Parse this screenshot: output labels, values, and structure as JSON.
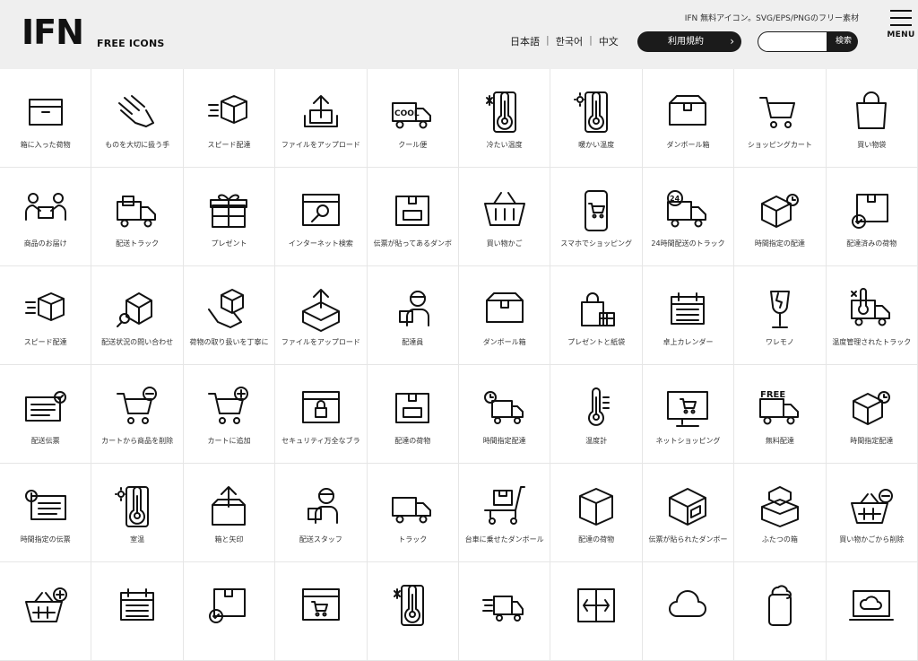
{
  "header": {
    "logo": "IFN",
    "logo_sub": "FREE ICONS",
    "tagline": "IFN 無料アイコン。SVG/EPS/PNGのフリー素材",
    "languages": [
      "日本語",
      "한국어",
      "中文"
    ],
    "terms_label": "利用規約",
    "search_button": "検索",
    "search_value": "",
    "menu_label": "MENU"
  },
  "icons": [
    {
      "label": "箱に入った荷物",
      "icon": "box-icon"
    },
    {
      "label": "ものを大切に扱う手",
      "icon": "hand-icon"
    },
    {
      "label": "スピード配達",
      "icon": "speed-box-icon"
    },
    {
      "label": "ファイルをアップロード",
      "icon": "upload-tray-icon"
    },
    {
      "label": "クール便",
      "icon": "cool-truck-icon"
    },
    {
      "label": "冷たい温度",
      "icon": "cold-thermometer-icon"
    },
    {
      "label": "暖かい温度",
      "icon": "warm-thermometer-icon"
    },
    {
      "label": "ダンボール箱",
      "icon": "cardboard-box-icon"
    },
    {
      "label": "ショッピングカート",
      "icon": "cart-icon"
    },
    {
      "label": "買い物袋",
      "icon": "shopping-bag-icon"
    },
    {
      "label": "商品のお届け",
      "icon": "handover-icon"
    },
    {
      "label": "配送トラック",
      "icon": "delivery-truck-icon"
    },
    {
      "label": "プレゼント",
      "icon": "gift-icon"
    },
    {
      "label": "インターネット検索",
      "icon": "browser-search-icon"
    },
    {
      "label": "伝票が貼ってあるダンボ",
      "icon": "box-label-icon"
    },
    {
      "label": "買い物かご",
      "icon": "basket-icon"
    },
    {
      "label": "スマホでショッピング",
      "icon": "phone-cart-icon"
    },
    {
      "label": "24時間配送のトラック",
      "icon": "truck-24-icon"
    },
    {
      "label": "時間指定の配達",
      "icon": "box-clock-icon"
    },
    {
      "label": "配達済みの荷物",
      "icon": "box-check-icon"
    },
    {
      "label": "スピード配達",
      "icon": "speed-box-icon"
    },
    {
      "label": "配送状況の問い合わせ",
      "icon": "box-search-icon"
    },
    {
      "label": "荷物の取り扱いを丁寧に",
      "icon": "hand-box-icon"
    },
    {
      "label": "ファイルをアップロード",
      "icon": "box-upload-icon"
    },
    {
      "label": "配達員",
      "icon": "courier-icon"
    },
    {
      "label": "ダンボール箱",
      "icon": "cardboard-box-icon"
    },
    {
      "label": "プレゼントと紙袋",
      "icon": "bag-gift-icon"
    },
    {
      "label": "卓上カレンダー",
      "icon": "calendar-icon"
    },
    {
      "label": "ワレモノ",
      "icon": "fragile-glass-icon"
    },
    {
      "label": "温度管理されたトラック",
      "icon": "thermo-truck-icon"
    },
    {
      "label": "配送伝票",
      "icon": "slip-check-icon"
    },
    {
      "label": "カートから商品を削除",
      "icon": "cart-minus-icon"
    },
    {
      "label": "カートに追加",
      "icon": "cart-plus-icon"
    },
    {
      "label": "セキュリティ万全なブラ",
      "icon": "browser-lock-icon"
    },
    {
      "label": "配達の荷物",
      "icon": "box-label-icon"
    },
    {
      "label": "時間指定配達",
      "icon": "clock-truck-icon"
    },
    {
      "label": "温度計",
      "icon": "thermometer-icon"
    },
    {
      "label": "ネットショッピング",
      "icon": "monitor-cart-icon"
    },
    {
      "label": "無料配達",
      "icon": "free-truck-icon"
    },
    {
      "label": "時間指定配達",
      "icon": "box-clock-icon"
    },
    {
      "label": "時間指定の伝票",
      "icon": "clock-slip-icon"
    },
    {
      "label": "室温",
      "icon": "warm-thermometer-icon"
    },
    {
      "label": "箱と矢印",
      "icon": "box-arrow-icon"
    },
    {
      "label": "配送スタッフ",
      "icon": "courier-icon"
    },
    {
      "label": "トラック",
      "icon": "truck-icon"
    },
    {
      "label": "台車に乗せたダンボール",
      "icon": "hand-cart-icon"
    },
    {
      "label": "配達の荷物",
      "icon": "box-3d-icon"
    },
    {
      "label": "伝票が貼られたダンボー",
      "icon": "box-slip-icon"
    },
    {
      "label": "ふたつの箱",
      "icon": "two-boxes-icon"
    },
    {
      "label": "買い物かごから削除",
      "icon": "basket-minus-icon"
    },
    {
      "label": "",
      "icon": "basket-plus-icon"
    },
    {
      "label": "",
      "icon": "calendar-icon"
    },
    {
      "label": "",
      "icon": "box-check-icon"
    },
    {
      "label": "",
      "icon": "browser-cart-icon"
    },
    {
      "label": "",
      "icon": "cold-thermometer-icon"
    },
    {
      "label": "",
      "icon": "speed-truck-icon"
    },
    {
      "label": "",
      "icon": "exchange-icon"
    },
    {
      "label": "",
      "icon": "cloud-icon"
    },
    {
      "label": "",
      "icon": "phone-cloud-icon"
    },
    {
      "label": "",
      "icon": "laptop-cloud-icon"
    }
  ]
}
